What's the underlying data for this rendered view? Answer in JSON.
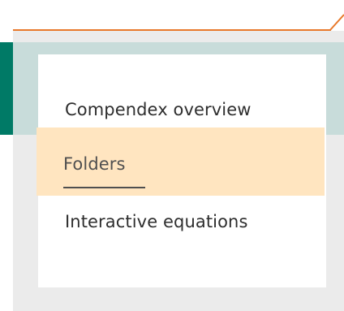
{
  "menu": {
    "items": [
      {
        "label": "Compendex overview",
        "active": false
      },
      {
        "label": "Folders",
        "active": true
      },
      {
        "label": "Interactive equations",
        "active": false
      }
    ]
  },
  "colors": {
    "accent_orange": "#e8792b",
    "accent_green": "#007a66",
    "teal_band": "#c8dcda",
    "active_highlight": "#ffe5c0",
    "backdrop": "#ebebeb"
  }
}
